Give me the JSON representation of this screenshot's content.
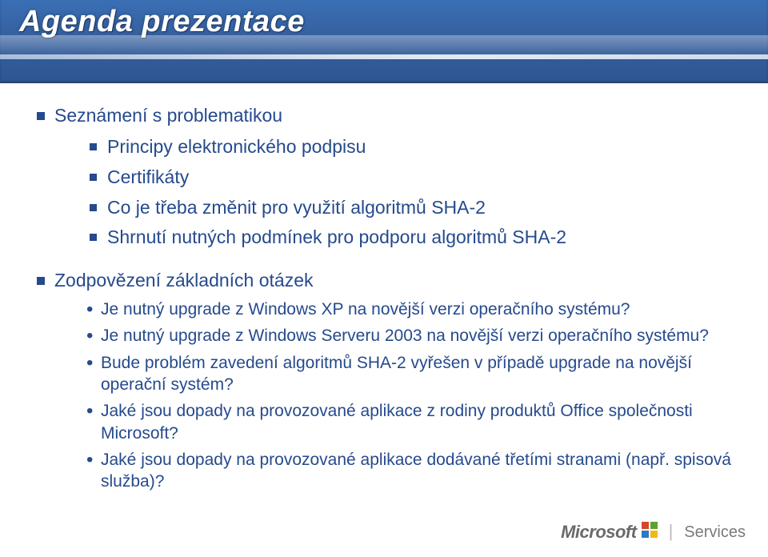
{
  "title": "Agenda prezentace",
  "bullets_lvl1": {
    "b0": "Seznámení s problematikou",
    "b1": "Zodpovězení základních otázek"
  },
  "sub_of_0": {
    "s0": "Principy elektronického podpisu",
    "s1": "Certifikáty",
    "s2": "Co je třeba změnit pro využití algoritmů SHA-2",
    "s3": "Shrnutí nutných podmínek pro podporu algoritmů SHA-2"
  },
  "sub_of_1": {
    "q0": "Je nutný upgrade z Windows XP na novější verzi operačního systému?",
    "q1": "Je nutný upgrade z Windows Serveru 2003 na novější verzi operačního systému?",
    "q2": "Bude problém zavedení algoritmů SHA-2 vyřešen v případě upgrade na novější operační systém?",
    "q3": "Jaké jsou dopady na provozované aplikace z rodiny produktů Office společnosti Microsoft?",
    "q4": "Jaké jsou dopady na provozované aplikace dodávané třetími stranami (např. spisová služba)?"
  },
  "logo": {
    "brand": "Microsoft",
    "product": "Services"
  }
}
